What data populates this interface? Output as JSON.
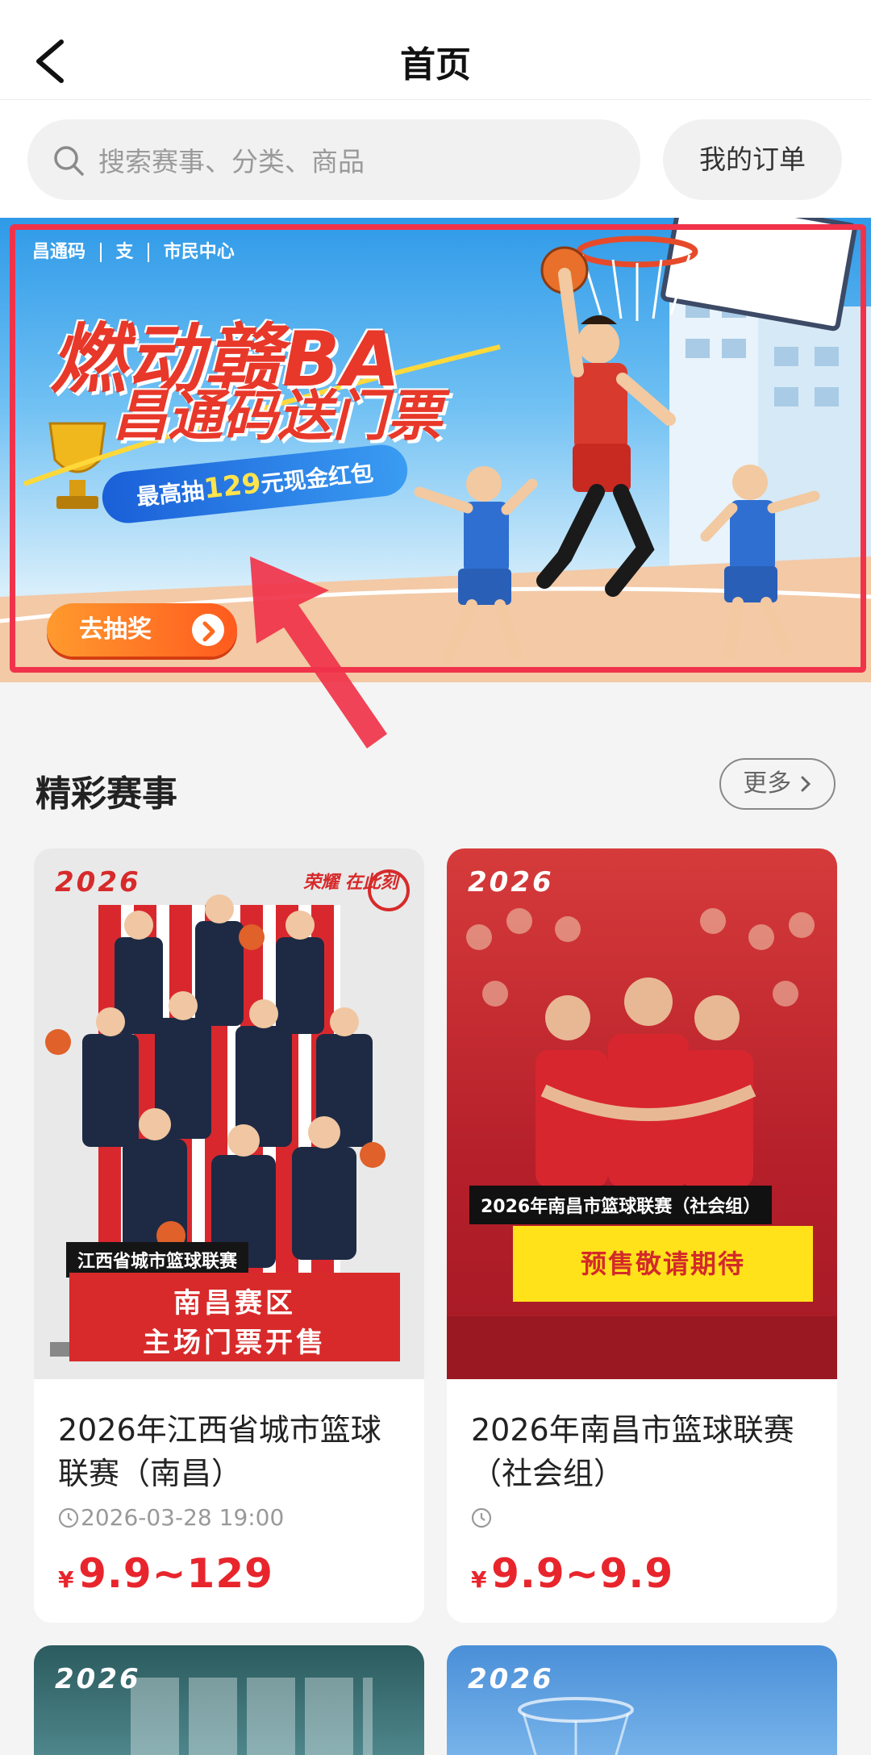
{
  "header": {
    "title": "首页"
  },
  "search": {
    "placeholder": "搜索赛事、分类、商品",
    "orders_label": "我的订单"
  },
  "banner": {
    "logos": [
      "昌通码",
      "支",
      "市民中心"
    ],
    "headline": "燃动赣BA",
    "subline": "昌通码送门票",
    "pill_prefix": "最高抽",
    "pill_amount": "129",
    "pill_suffix": "元现金红包",
    "cta": "去抽奖"
  },
  "section": {
    "title": "精彩赛事",
    "more_label": "更多"
  },
  "events": [
    {
      "poster": {
        "year": "2026",
        "slogan": "荣耀 在此刻",
        "tag": "江西省城市篮球联赛",
        "line1": "南昌赛区",
        "line2": "主场门票开售"
      },
      "title": "2026年江西省城市篮球联赛（南昌）",
      "time": "2026-03-28 19:00",
      "currency": "¥",
      "price": "9.9~129"
    },
    {
      "poster": {
        "year": "2026",
        "tag": "2026年南昌市篮球联赛（社会组）",
        "highlight": "预售敬请期待"
      },
      "title": "2026年南昌市篮球联赛（社会组）",
      "time": "",
      "currency": "¥",
      "price": "9.9~9.9"
    },
    {
      "poster": {
        "year": "2026"
      }
    },
    {
      "poster": {
        "year": "2026"
      }
    }
  ],
  "colors": {
    "accent": "#e8252c",
    "annotation": "#f0334a",
    "cta": "#ff7a24",
    "highlight": "#ffe21a"
  }
}
